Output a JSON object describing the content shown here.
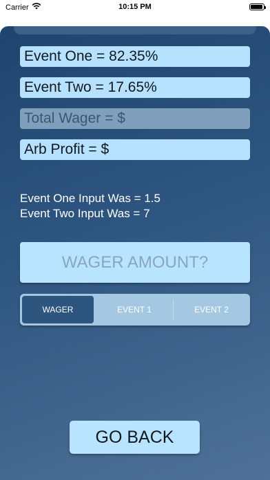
{
  "status_bar": {
    "carrier": "Carrier",
    "time": "10:15 PM",
    "icons": [
      "wifi-icon",
      "battery-icon"
    ]
  },
  "results": {
    "event_one": "Event One = 82.35%",
    "event_two": "Event Two = 17.65%",
    "total_wager": "Total Wager = $",
    "arb_profit": "Arb Profit = $"
  },
  "inputs_summary": {
    "event_one_input": "Event One Input Was = 1.5",
    "event_two_input": "Event Two Input Was = 7"
  },
  "wager_field": {
    "placeholder": "WAGER AMOUNT?",
    "value": ""
  },
  "segments": {
    "items": [
      "WAGER",
      "EVENT 1",
      "EVENT 2"
    ],
    "selected": "WAGER"
  },
  "go_back_label": "GO BACK",
  "colors": {
    "field_bg": "#b6e2ff",
    "disabled_field_bg": "#7f9fbd",
    "background_top": "#1f4470",
    "background_bottom": "#4f7198",
    "selected_segment": "#2d557e"
  }
}
